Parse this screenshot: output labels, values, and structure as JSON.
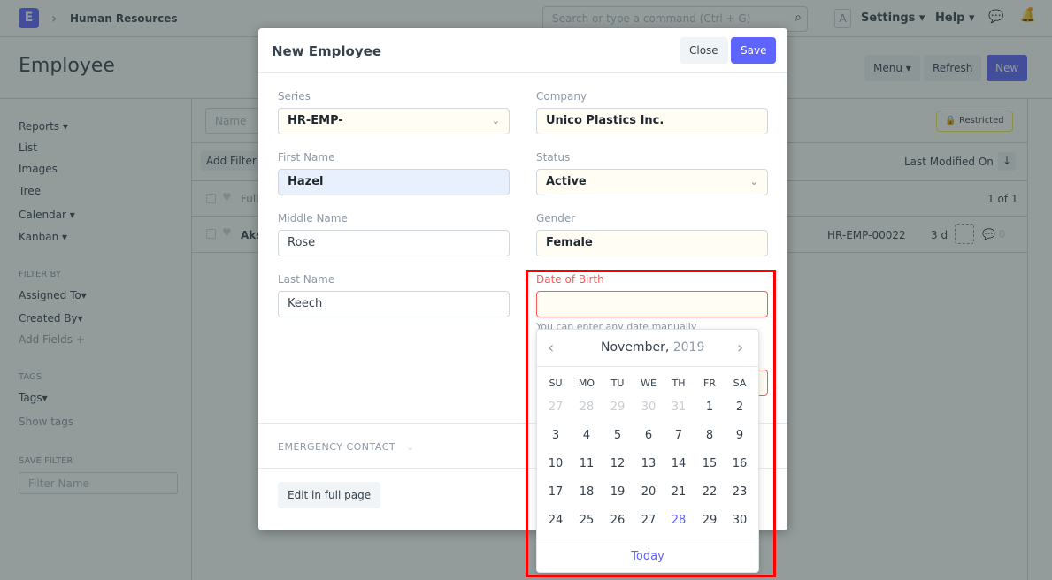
{
  "navbar": {
    "logo": "E",
    "breadcrumb": "Human Resources",
    "search_placeholder": "Search or type a command (Ctrl + G)",
    "avatar": "A",
    "settings": "Settings",
    "help": "Help",
    "icons": [
      "search-icon",
      "chat-icon",
      "bell-icon"
    ],
    "notification_dot_color": "#ff9800"
  },
  "page": {
    "title": "Employee",
    "menu": "Menu",
    "refresh": "Refresh",
    "new": "New"
  },
  "sidebar": {
    "items": [
      "Reports",
      "List",
      "Images",
      "Tree",
      "Calendar",
      "Kanban"
    ],
    "filter_by": "FILTER BY",
    "filters": [
      "Assigned To",
      "Created By",
      "Add Fields"
    ],
    "tags_caption": "TAGS",
    "tags": "Tags",
    "show_tags": "Show tags",
    "save_filter": "SAVE FILTER",
    "filter_placeholder": "Filter Name"
  },
  "list": {
    "name_placeholder": "Name",
    "add_filter": "Add Filter",
    "restricted": "Restricted",
    "sort": "Last Modified On",
    "header_col": "Full",
    "count": "1 of 1",
    "row": {
      "name": "Aks",
      "id": "HR-EMP-00022",
      "modified": "3 d",
      "comments": "0"
    }
  },
  "modal": {
    "title": "New Employee",
    "close": "Close",
    "save": "Save",
    "fields": {
      "series": {
        "label": "Series",
        "value": "HR-EMP-"
      },
      "first_name": {
        "label": "First Name",
        "value": "Hazel"
      },
      "middle_name": {
        "label": "Middle Name",
        "value": "Rose"
      },
      "last_name": {
        "label": "Last Name",
        "value": "Keech"
      },
      "company": {
        "label": "Company",
        "value": "Unico Plastics Inc."
      },
      "status": {
        "label": "Status",
        "value": "Active"
      },
      "gender": {
        "label": "Gender",
        "value": "Female"
      },
      "dob": {
        "label": "Date of Birth",
        "value": "",
        "help": "You can enter any date manually"
      }
    },
    "section": "EMERGENCY CONTACT",
    "edit_full": "Edit in full page"
  },
  "datepicker": {
    "month": "November,",
    "year": "2019",
    "weekdays": [
      "SU",
      "MO",
      "TU",
      "WE",
      "TH",
      "FR",
      "SA"
    ],
    "weeks": [
      [
        "27",
        "28",
        "29",
        "30",
        "31",
        "1",
        "2"
      ],
      [
        "3",
        "4",
        "5",
        "6",
        "7",
        "8",
        "9"
      ],
      [
        "10",
        "11",
        "12",
        "13",
        "14",
        "15",
        "16"
      ],
      [
        "17",
        "18",
        "19",
        "20",
        "21",
        "22",
        "23"
      ],
      [
        "24",
        "25",
        "26",
        "27",
        "28",
        "29",
        "30"
      ]
    ],
    "today_date": "28",
    "today": "Today"
  },
  "colors": {
    "primary": "#5e64ff",
    "error": "#ff5858",
    "annotation": "#ff0000"
  }
}
